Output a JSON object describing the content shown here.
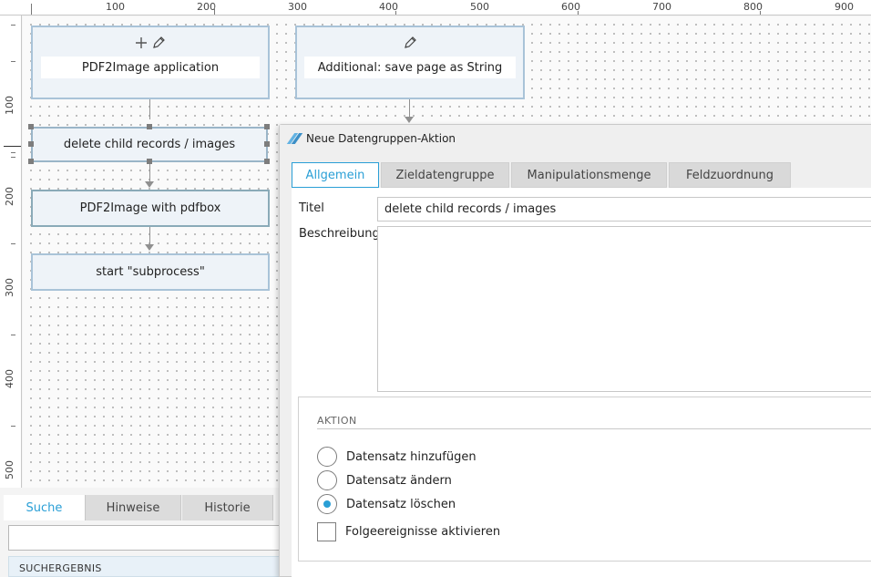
{
  "ruler": {
    "top_labels": [
      "100",
      "200",
      "300",
      "400",
      "500",
      "600",
      "700",
      "800",
      "900"
    ],
    "left_labels": [
      "100",
      "200",
      "300",
      "400",
      "500"
    ]
  },
  "flow": {
    "nodes": [
      {
        "label": "PDF2Image application",
        "icons": [
          "plus-icon",
          "pencil-icon"
        ]
      },
      {
        "label": "Additional: save page as String",
        "icons": [
          "pencil-icon"
        ]
      },
      {
        "label": "delete child records / images"
      },
      {
        "label": "PDF2Image with pdfbox"
      },
      {
        "label": "start \"subprocess\""
      }
    ]
  },
  "bottom_panel": {
    "tabs": [
      "Suche",
      "Hinweise",
      "Historie"
    ],
    "active_tab": "Suche",
    "search_value": "",
    "results_header": "SUCHERGEBNIS"
  },
  "dialog": {
    "title": "Neue Datengruppen-Aktion",
    "tabs": [
      "Allgemein",
      "Zieldatengruppe",
      "Manipulationsmenge",
      "Feldzuordnung"
    ],
    "active_tab": "Allgemein",
    "titel_label": "Titel",
    "titel_value": "delete child records / images",
    "beschreibung_label": "Beschreibung",
    "beschreibung_value": "",
    "aktion_title": "AKTION",
    "options": [
      {
        "label": "Datensatz hinzufügen",
        "checked": false
      },
      {
        "label": "Datensatz ändern",
        "checked": false
      },
      {
        "label": "Datensatz löschen",
        "checked": true
      }
    ],
    "followup_label": "Folgeereignisse aktivieren",
    "followup_checked": false
  },
  "colors": {
    "accent": "#2a9fd6",
    "node_fill": "#eef3f8",
    "node_border": "#a9c3d8"
  }
}
